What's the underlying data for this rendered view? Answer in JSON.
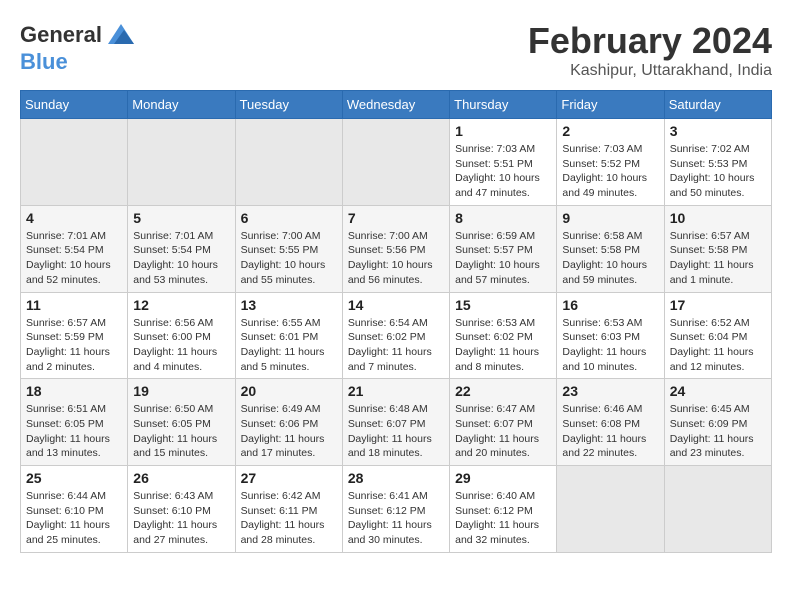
{
  "header": {
    "logo_line1": "General",
    "logo_line2": "Blue",
    "title": "February 2024",
    "subtitle": "Kashipur, Uttarakhand, India"
  },
  "days_of_week": [
    "Sunday",
    "Monday",
    "Tuesday",
    "Wednesday",
    "Thursday",
    "Friday",
    "Saturday"
  ],
  "weeks": [
    [
      {
        "num": "",
        "info": ""
      },
      {
        "num": "",
        "info": ""
      },
      {
        "num": "",
        "info": ""
      },
      {
        "num": "",
        "info": ""
      },
      {
        "num": "1",
        "info": "Sunrise: 7:03 AM\nSunset: 5:51 PM\nDaylight: 10 hours\nand 47 minutes."
      },
      {
        "num": "2",
        "info": "Sunrise: 7:03 AM\nSunset: 5:52 PM\nDaylight: 10 hours\nand 49 minutes."
      },
      {
        "num": "3",
        "info": "Sunrise: 7:02 AM\nSunset: 5:53 PM\nDaylight: 10 hours\nand 50 minutes."
      }
    ],
    [
      {
        "num": "4",
        "info": "Sunrise: 7:01 AM\nSunset: 5:54 PM\nDaylight: 10 hours\nand 52 minutes."
      },
      {
        "num": "5",
        "info": "Sunrise: 7:01 AM\nSunset: 5:54 PM\nDaylight: 10 hours\nand 53 minutes."
      },
      {
        "num": "6",
        "info": "Sunrise: 7:00 AM\nSunset: 5:55 PM\nDaylight: 10 hours\nand 55 minutes."
      },
      {
        "num": "7",
        "info": "Sunrise: 7:00 AM\nSunset: 5:56 PM\nDaylight: 10 hours\nand 56 minutes."
      },
      {
        "num": "8",
        "info": "Sunrise: 6:59 AM\nSunset: 5:57 PM\nDaylight: 10 hours\nand 57 minutes."
      },
      {
        "num": "9",
        "info": "Sunrise: 6:58 AM\nSunset: 5:58 PM\nDaylight: 10 hours\nand 59 minutes."
      },
      {
        "num": "10",
        "info": "Sunrise: 6:57 AM\nSunset: 5:58 PM\nDaylight: 11 hours\nand 1 minute."
      }
    ],
    [
      {
        "num": "11",
        "info": "Sunrise: 6:57 AM\nSunset: 5:59 PM\nDaylight: 11 hours\nand 2 minutes."
      },
      {
        "num": "12",
        "info": "Sunrise: 6:56 AM\nSunset: 6:00 PM\nDaylight: 11 hours\nand 4 minutes."
      },
      {
        "num": "13",
        "info": "Sunrise: 6:55 AM\nSunset: 6:01 PM\nDaylight: 11 hours\nand 5 minutes."
      },
      {
        "num": "14",
        "info": "Sunrise: 6:54 AM\nSunset: 6:02 PM\nDaylight: 11 hours\nand 7 minutes."
      },
      {
        "num": "15",
        "info": "Sunrise: 6:53 AM\nSunset: 6:02 PM\nDaylight: 11 hours\nand 8 minutes."
      },
      {
        "num": "16",
        "info": "Sunrise: 6:53 AM\nSunset: 6:03 PM\nDaylight: 11 hours\nand 10 minutes."
      },
      {
        "num": "17",
        "info": "Sunrise: 6:52 AM\nSunset: 6:04 PM\nDaylight: 11 hours\nand 12 minutes."
      }
    ],
    [
      {
        "num": "18",
        "info": "Sunrise: 6:51 AM\nSunset: 6:05 PM\nDaylight: 11 hours\nand 13 minutes."
      },
      {
        "num": "19",
        "info": "Sunrise: 6:50 AM\nSunset: 6:05 PM\nDaylight: 11 hours\nand 15 minutes."
      },
      {
        "num": "20",
        "info": "Sunrise: 6:49 AM\nSunset: 6:06 PM\nDaylight: 11 hours\nand 17 minutes."
      },
      {
        "num": "21",
        "info": "Sunrise: 6:48 AM\nSunset: 6:07 PM\nDaylight: 11 hours\nand 18 minutes."
      },
      {
        "num": "22",
        "info": "Sunrise: 6:47 AM\nSunset: 6:07 PM\nDaylight: 11 hours\nand 20 minutes."
      },
      {
        "num": "23",
        "info": "Sunrise: 6:46 AM\nSunset: 6:08 PM\nDaylight: 11 hours\nand 22 minutes."
      },
      {
        "num": "24",
        "info": "Sunrise: 6:45 AM\nSunset: 6:09 PM\nDaylight: 11 hours\nand 23 minutes."
      }
    ],
    [
      {
        "num": "25",
        "info": "Sunrise: 6:44 AM\nSunset: 6:10 PM\nDaylight: 11 hours\nand 25 minutes."
      },
      {
        "num": "26",
        "info": "Sunrise: 6:43 AM\nSunset: 6:10 PM\nDaylight: 11 hours\nand 27 minutes."
      },
      {
        "num": "27",
        "info": "Sunrise: 6:42 AM\nSunset: 6:11 PM\nDaylight: 11 hours\nand 28 minutes."
      },
      {
        "num": "28",
        "info": "Sunrise: 6:41 AM\nSunset: 6:12 PM\nDaylight: 11 hours\nand 30 minutes."
      },
      {
        "num": "29",
        "info": "Sunrise: 6:40 AM\nSunset: 6:12 PM\nDaylight: 11 hours\nand 32 minutes."
      },
      {
        "num": "",
        "info": ""
      },
      {
        "num": "",
        "info": ""
      }
    ]
  ]
}
